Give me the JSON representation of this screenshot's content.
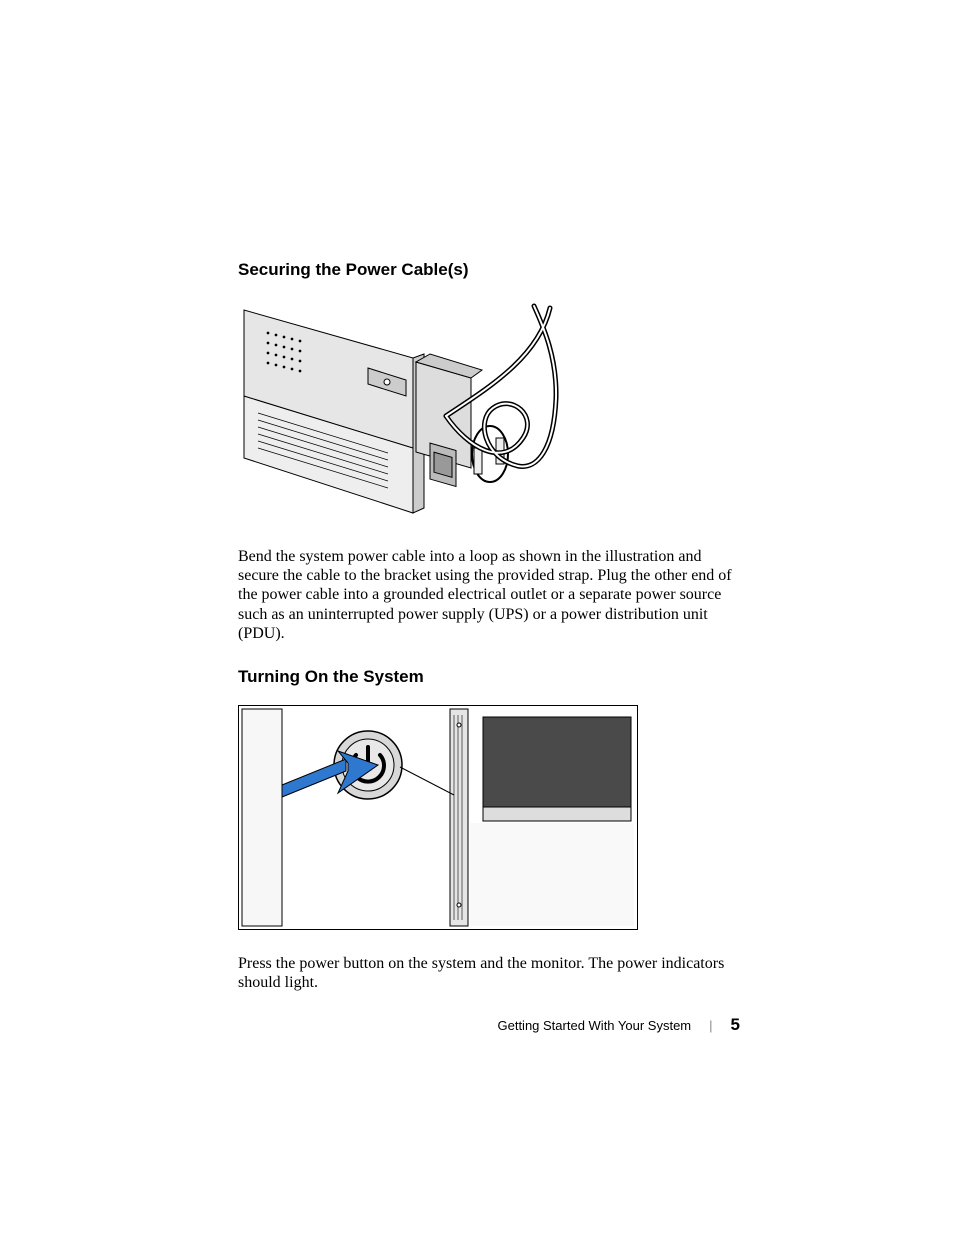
{
  "headings": {
    "securing": "Securing the Power Cable(s)",
    "turning_on": "Turning On the System"
  },
  "paragraphs": {
    "securing": "Bend the system power cable into a loop as shown in the illustration and secure the cable to the bracket using the provided strap. Plug the other end of the power cable into a grounded electrical outlet or a separate power source such as an uninterrupted power supply (UPS) or a power distribution unit (PDU).",
    "turning_on": "Press the power button on the system and the monitor. The power indicators should light."
  },
  "footer": {
    "section": "Getting Started With Your System",
    "page": "5"
  },
  "figures": {
    "fig1_alt": "Illustration of power cable looped and secured to bracket on rear of rack-mounted system",
    "fig2_alt": "Illustration of pressing the power button on the system front panel"
  }
}
